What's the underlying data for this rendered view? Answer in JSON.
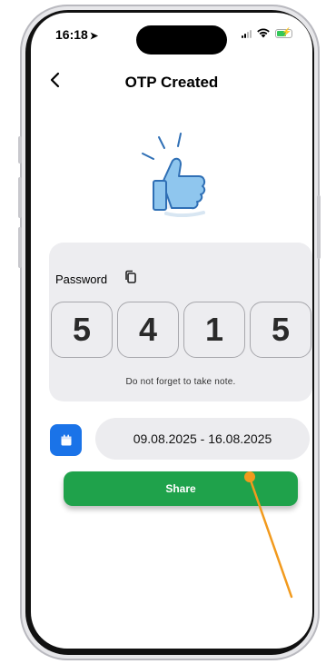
{
  "status_bar": {
    "time": "16:18",
    "location_arrow": "location-arrow-icon",
    "icons": [
      "signal-icon",
      "wifi-icon",
      "battery-charging-icon"
    ]
  },
  "nav": {
    "back_icon": "chevron-left-icon",
    "title": "OTP Created"
  },
  "illustration": "thumbs-up-icon",
  "password_card": {
    "label": "Password",
    "copy_icon": "copy-icon",
    "digits": [
      "5",
      "4",
      "1",
      "5"
    ],
    "note": "Do not forget to take note."
  },
  "date_row": {
    "calendar_icon": "calendar-icon",
    "range": "09.08.2025 - 16.08.2025"
  },
  "share_button": {
    "label": "Share"
  },
  "colors": {
    "accent_blue": "#1a73e8",
    "share_green": "#1fa24b",
    "card_bg": "#ededf0",
    "annotation_orange": "#f29a1d"
  }
}
